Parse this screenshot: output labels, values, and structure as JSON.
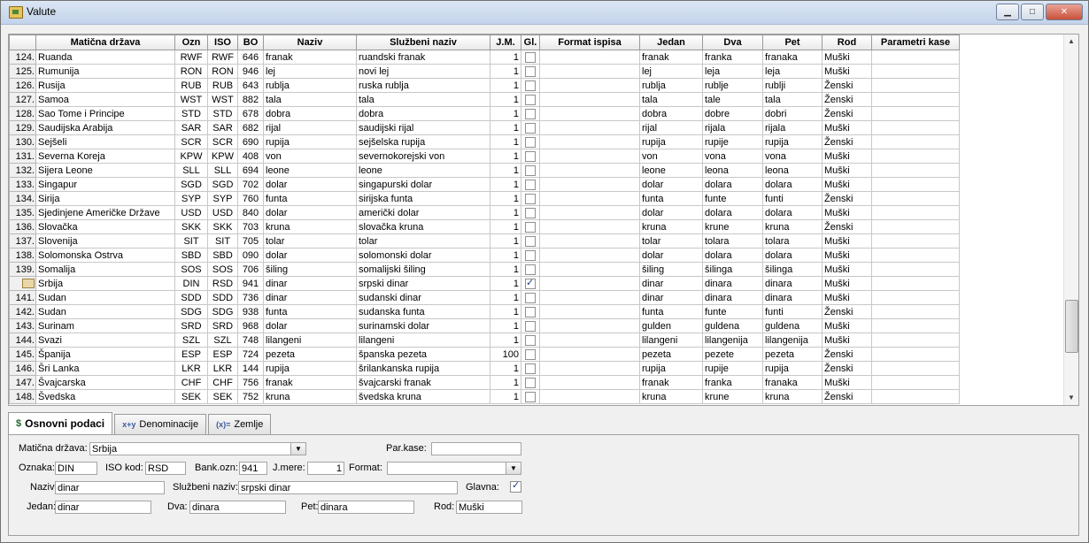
{
  "window": {
    "title": "Valute",
    "minimize": "▁",
    "maximize": "□",
    "close": "✕"
  },
  "columns": [
    "Matična država",
    "Ozn",
    "ISO",
    "BO",
    "Naziv",
    "Službeni naziv",
    "J.M.",
    "Gl.",
    "Format ispisa",
    "Jedan",
    "Dva",
    "Pet",
    "Rod",
    "Parametri kase"
  ],
  "rows": [
    {
      "n": "124.",
      "drzava": "Ruanda",
      "ozn": "RWF",
      "iso": "RWF",
      "bo": "646",
      "naziv": "franak",
      "sluzbeni": "ruandski franak",
      "jm": "1",
      "gl": false,
      "jedan": "franak",
      "dva": "franka",
      "pet": "franaka",
      "rod": "Muški"
    },
    {
      "n": "125.",
      "drzava": "Rumunija",
      "ozn": "RON",
      "iso": "RON",
      "bo": "946",
      "naziv": "lej",
      "sluzbeni": "novi lej",
      "jm": "1",
      "gl": false,
      "jedan": "lej",
      "dva": "leja",
      "pet": "leja",
      "rod": "Muški"
    },
    {
      "n": "126.",
      "drzava": "Rusija",
      "ozn": "RUB",
      "iso": "RUB",
      "bo": "643",
      "naziv": "rublja",
      "sluzbeni": "ruska rublja",
      "jm": "1",
      "gl": false,
      "jedan": "rublja",
      "dva": "rublje",
      "pet": "rublji",
      "rod": "Ženski"
    },
    {
      "n": "127.",
      "drzava": "Samoa",
      "ozn": "WST",
      "iso": "WST",
      "bo": "882",
      "naziv": "tala",
      "sluzbeni": "tala",
      "jm": "1",
      "gl": false,
      "jedan": "tala",
      "dva": "tale",
      "pet": "tala",
      "rod": "Ženski"
    },
    {
      "n": "128.",
      "drzava": "Sao Tome i Principe",
      "ozn": "STD",
      "iso": "STD",
      "bo": "678",
      "naziv": "dobra",
      "sluzbeni": "dobra",
      "jm": "1",
      "gl": false,
      "jedan": "dobra",
      "dva": "dobre",
      "pet": "dobri",
      "rod": "Ženski"
    },
    {
      "n": "129.",
      "drzava": "Saudijska Arabija",
      "ozn": "SAR",
      "iso": "SAR",
      "bo": "682",
      "naziv": "rijal",
      "sluzbeni": "saudijski rijal",
      "jm": "1",
      "gl": false,
      "jedan": "rijal",
      "dva": "rijala",
      "pet": "rijala",
      "rod": "Muški"
    },
    {
      "n": "130.",
      "drzava": "Sejšeli",
      "ozn": "SCR",
      "iso": "SCR",
      "bo": "690",
      "naziv": "rupija",
      "sluzbeni": "sejšelska rupija",
      "jm": "1",
      "gl": false,
      "jedan": "rupija",
      "dva": "rupije",
      "pet": "rupija",
      "rod": "Ženski"
    },
    {
      "n": "131.",
      "drzava": "Severna Koreja",
      "ozn": "KPW",
      "iso": "KPW",
      "bo": "408",
      "naziv": "von",
      "sluzbeni": "severnokorejski von",
      "jm": "1",
      "gl": false,
      "jedan": "von",
      "dva": "vona",
      "pet": "vona",
      "rod": "Muški"
    },
    {
      "n": "132.",
      "drzava": "Sijera Leone",
      "ozn": "SLL",
      "iso": "SLL",
      "bo": "694",
      "naziv": "leone",
      "sluzbeni": "leone",
      "jm": "1",
      "gl": false,
      "jedan": "leone",
      "dva": "leona",
      "pet": "leona",
      "rod": "Muški"
    },
    {
      "n": "133.",
      "drzava": "Singapur",
      "ozn": "SGD",
      "iso": "SGD",
      "bo": "702",
      "naziv": "dolar",
      "sluzbeni": "singapurski dolar",
      "jm": "1",
      "gl": false,
      "jedan": "dolar",
      "dva": "dolara",
      "pet": "dolara",
      "rod": "Muški"
    },
    {
      "n": "134.",
      "drzava": "Sirija",
      "ozn": "SYP",
      "iso": "SYP",
      "bo": "760",
      "naziv": "funta",
      "sluzbeni": "sirijska funta",
      "jm": "1",
      "gl": false,
      "jedan": "funta",
      "dva": "funte",
      "pet": "funti",
      "rod": "Ženski"
    },
    {
      "n": "135.",
      "drzava": "Sjedinjene Američke Države",
      "ozn": "USD",
      "iso": "USD",
      "bo": "840",
      "naziv": "dolar",
      "sluzbeni": "američki dolar",
      "jm": "1",
      "gl": false,
      "jedan": "dolar",
      "dva": "dolara",
      "pet": "dolara",
      "rod": "Muški"
    },
    {
      "n": "136.",
      "drzava": "Slovačka",
      "ozn": "SKK",
      "iso": "SKK",
      "bo": "703",
      "naziv": "kruna",
      "sluzbeni": "slovačka kruna",
      "jm": "1",
      "gl": false,
      "jedan": "kruna",
      "dva": "krune",
      "pet": "kruna",
      "rod": "Ženski"
    },
    {
      "n": "137.",
      "drzava": "Slovenija",
      "ozn": "SIT",
      "iso": "SIT",
      "bo": "705",
      "naziv": "tolar",
      "sluzbeni": "tolar",
      "jm": "1",
      "gl": false,
      "jedan": "tolar",
      "dva": "tolara",
      "pet": "tolara",
      "rod": "Muški"
    },
    {
      "n": "138.",
      "drzava": "Solomonska Ostrva",
      "ozn": "SBD",
      "iso": "SBD",
      "bo": "090",
      "naziv": "dolar",
      "sluzbeni": "solomonski dolar",
      "jm": "1",
      "gl": false,
      "jedan": "dolar",
      "dva": "dolara",
      "pet": "dolara",
      "rod": "Muški"
    },
    {
      "n": "139.",
      "drzava": "Somalija",
      "ozn": "SOS",
      "iso": "SOS",
      "bo": "706",
      "naziv": "šiling",
      "sluzbeni": "somalijski šiling",
      "jm": "1",
      "gl": false,
      "jedan": "šiling",
      "dva": "šilinga",
      "pet": "šilinga",
      "rod": "Muški"
    },
    {
      "n": "",
      "drzava": "Srbija",
      "ozn": "DIN",
      "iso": "RSD",
      "bo": "941",
      "naziv": "dinar",
      "sluzbeni": "srpski dinar",
      "jm": "1",
      "gl": true,
      "jedan": "dinar",
      "dva": "dinara",
      "pet": "dinara",
      "rod": "Muški",
      "selected": true
    },
    {
      "n": "141.",
      "drzava": "Sudan",
      "ozn": "SDD",
      "iso": "SDD",
      "bo": "736",
      "naziv": "dinar",
      "sluzbeni": "sudanski dinar",
      "jm": "1",
      "gl": false,
      "jedan": "dinar",
      "dva": "dinara",
      "pet": "dinara",
      "rod": "Muški"
    },
    {
      "n": "142.",
      "drzava": "Sudan",
      "ozn": "SDG",
      "iso": "SDG",
      "bo": "938",
      "naziv": "funta",
      "sluzbeni": "sudanska funta",
      "jm": "1",
      "gl": false,
      "jedan": "funta",
      "dva": "funte",
      "pet": "funti",
      "rod": "Ženski"
    },
    {
      "n": "143.",
      "drzava": "Surinam",
      "ozn": "SRD",
      "iso": "SRD",
      "bo": "968",
      "naziv": "dolar",
      "sluzbeni": "surinamski dolar",
      "jm": "1",
      "gl": false,
      "jedan": "gulden",
      "dva": "guldena",
      "pet": "guldena",
      "rod": "Muški"
    },
    {
      "n": "144.",
      "drzava": "Svazi",
      "ozn": "SZL",
      "iso": "SZL",
      "bo": "748",
      "naziv": "lilangeni",
      "sluzbeni": "lilangeni",
      "jm": "1",
      "gl": false,
      "jedan": "lilangeni",
      "dva": "lilangenija",
      "pet": "lilangenija",
      "rod": "Muški"
    },
    {
      "n": "145.",
      "drzava": "Španija",
      "ozn": "ESP",
      "iso": "ESP",
      "bo": "724",
      "naziv": "pezeta",
      "sluzbeni": "španska pezeta",
      "jm": "100",
      "gl": false,
      "jedan": "pezeta",
      "dva": "pezete",
      "pet": "pezeta",
      "rod": "Ženski"
    },
    {
      "n": "146.",
      "drzava": "Šri Lanka",
      "ozn": "LKR",
      "iso": "LKR",
      "bo": "144",
      "naziv": "rupija",
      "sluzbeni": "šrilankanska rupija",
      "jm": "1",
      "gl": false,
      "jedan": "rupija",
      "dva": "rupije",
      "pet": "rupija",
      "rod": "Ženski"
    },
    {
      "n": "147.",
      "drzava": "Švajcarska",
      "ozn": "CHF",
      "iso": "CHF",
      "bo": "756",
      "naziv": "franak",
      "sluzbeni": "švajcarski franak",
      "jm": "1",
      "gl": false,
      "jedan": "franak",
      "dva": "franka",
      "pet": "franaka",
      "rod": "Muški"
    },
    {
      "n": "148.",
      "drzava": "Švedska",
      "ozn": "SEK",
      "iso": "SEK",
      "bo": "752",
      "naziv": "kruna",
      "sluzbeni": "švedska kruna",
      "jm": "1",
      "gl": false,
      "jedan": "kruna",
      "dva": "krune",
      "pet": "kruna",
      "rod": "Ženski"
    }
  ],
  "tabs": [
    {
      "label": "Osnovni podaci",
      "icon": "$",
      "active": true
    },
    {
      "label": "Denominacije",
      "icon": "x+y",
      "active": false
    },
    {
      "label": "Zemlje",
      "icon": "(x)=",
      "active": false
    }
  ],
  "form": {
    "maticna_label": "Matična država:",
    "maticna_value": "Srbija",
    "parkase_label": "Par.kase:",
    "parkase_value": "",
    "oznaka_label": "Oznaka:",
    "oznaka_value": "DIN",
    "iso_label": "ISO kod:",
    "iso_value": "RSD",
    "bank_label": "Bank.ozn:",
    "bank_value": "941",
    "jmere_label": "J.mere:",
    "jmere_value": "1",
    "format_label": "Format:",
    "format_value": "",
    "naziv_label": "Naziv:",
    "naziv_value": "dinar",
    "sluzbeni_label": "Službeni naziv:",
    "sluzbeni_value": "srpski dinar",
    "glavna_label": "Glavna:",
    "glavna_checked": true,
    "jedan_label": "Jedan:",
    "jedan_value": "dinar",
    "dva_label": "Dva:",
    "dva_value": "dinara",
    "pet_label": "Pet:",
    "pet_value": "dinara",
    "rod_label": "Rod:",
    "rod_value": "Muški"
  },
  "colors": {
    "title_bg": "#c3d3ea",
    "close_btn": "#c7503a",
    "check": "#1b3a8a"
  },
  "icons": {
    "app": "folder-icon",
    "dropdown": "chevron-down-icon",
    "scroll_up": "arrow-up-icon",
    "scroll_down": "arrow-down-icon"
  }
}
